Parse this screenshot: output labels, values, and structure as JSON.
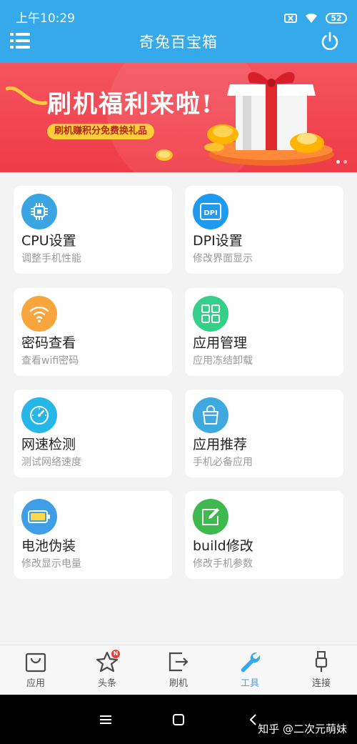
{
  "status_bar": {
    "time": "上午10:29",
    "battery": "52"
  },
  "header": {
    "title": "奇兔百宝箱"
  },
  "banner": {
    "headline": "刷机福利来啦!",
    "subtitle": "刷机赚积分免费换礼品",
    "page_count": 2,
    "active_page": 1
  },
  "tools": [
    {
      "name": "CPU设置",
      "desc": "调整手机性能",
      "icon": "cpu-icon",
      "color": "#3aa5e3"
    },
    {
      "name": "DPI设置",
      "desc": "修改界面显示",
      "icon": "dpi-icon",
      "color": "#1e9af0"
    },
    {
      "name": "密码查看",
      "desc": "查看wifi密码",
      "icon": "wifi-icon",
      "color": "#f7a53c"
    },
    {
      "name": "应用管理",
      "desc": "应用冻结卸载",
      "icon": "grid-icon",
      "color": "#35cf8a"
    },
    {
      "name": "网速检测",
      "desc": "测试网络速度",
      "icon": "speedometer-icon",
      "color": "#27b6e8"
    },
    {
      "name": "应用推荐",
      "desc": "手机必备应用",
      "icon": "shopping-bag-icon",
      "color": "#3fa8de"
    },
    {
      "name": "电池伪装",
      "desc": "修改显示电量",
      "icon": "battery-icon",
      "color": "#3f9fe6"
    },
    {
      "name": "build修改",
      "desc": "修改手机参数",
      "icon": "edit-icon",
      "color": "#3fb84f"
    }
  ],
  "bottom_nav": [
    {
      "label": "应用",
      "icon": "bag-icon",
      "active": false
    },
    {
      "label": "头条",
      "icon": "star-icon",
      "active": false,
      "badge": "N"
    },
    {
      "label": "刷机",
      "icon": "export-icon",
      "active": false
    },
    {
      "label": "工具",
      "icon": "wrench-icon",
      "active": true
    },
    {
      "label": "连接",
      "icon": "usb-icon",
      "active": false
    }
  ],
  "colors": {
    "primary": "#35a9ea",
    "banner_red": "#ef3b48",
    "background": "#f3f3f3"
  },
  "watermark": "知乎 @二次元萌妹"
}
